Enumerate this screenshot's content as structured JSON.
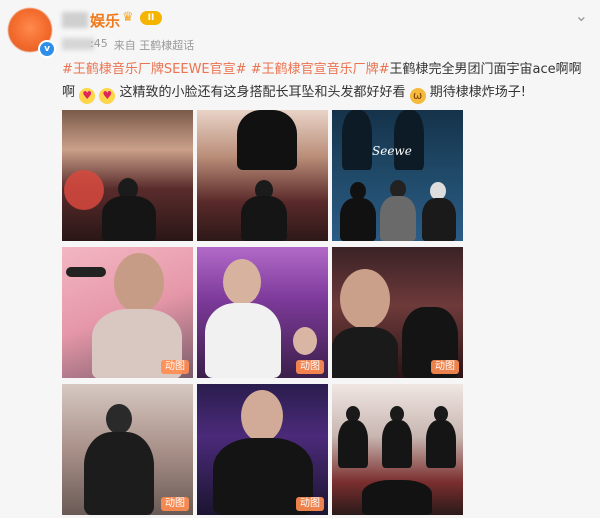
{
  "post": {
    "username": "娱乐",
    "level_badge": "II",
    "time": ":45",
    "source": "来自 王鹤棣超话",
    "verified_mark": "v",
    "more_icon": "chevron-down-icon",
    "content": {
      "tag1": "#王鹤棣音乐厂牌SEEWE官宣#",
      "tag2": "#王鹤棣官宣音乐厂牌#",
      "text1": "王鹤棣完全男团门面宇宙ace啊啊啊",
      "text2": "这精致的小脸还有这身搭配长耳坠和头发都好好看",
      "text3": "期待棣棣炸场子!"
    },
    "images": [
      {
        "gif": ""
      },
      {
        "gif": ""
      },
      {
        "gif": "",
        "overlay_text": "Seewe"
      },
      {
        "gif": "动图"
      },
      {
        "gif": "动图"
      },
      {
        "gif": "动图"
      },
      {
        "gif": "动图"
      },
      {
        "gif": "动图"
      },
      {
        "gif": ""
      }
    ]
  }
}
